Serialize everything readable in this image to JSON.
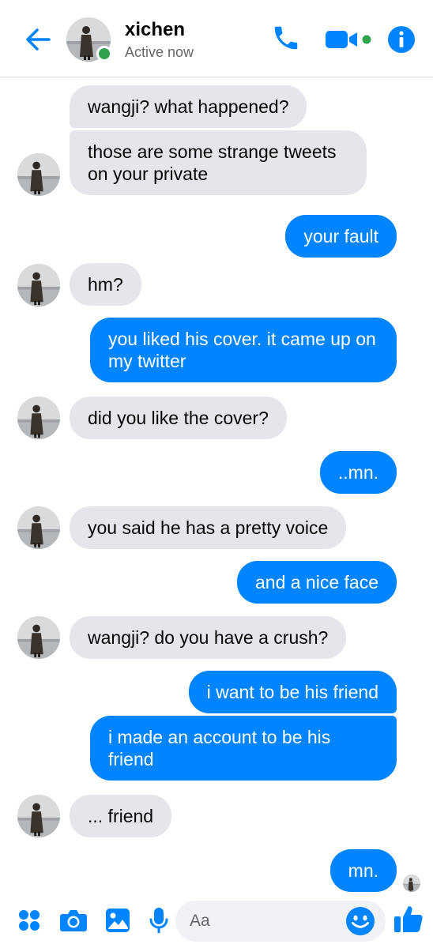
{
  "header": {
    "contact_name": "xichen",
    "status": "Active now",
    "status_color": "#31a24c"
  },
  "icons": {
    "back": "arrow-left-icon",
    "call": "phone-icon",
    "video": "video-camera-icon",
    "info": "info-icon",
    "apps": "apps-grid-icon",
    "camera": "camera-icon",
    "gallery": "image-icon",
    "mic": "microphone-icon",
    "emoji": "smiley-icon",
    "like": "thumbs-up-icon"
  },
  "colors": {
    "accent": "#0084ff",
    "received_bubble": "#e4e6eb",
    "sent_bubble": "#0084ff"
  },
  "messages": [
    {
      "dir": "received",
      "text": "wangji? what happened?"
    },
    {
      "dir": "received",
      "text": "those are some strange tweets on your private"
    },
    {
      "dir": "sent",
      "text": "your fault"
    },
    {
      "dir": "received",
      "text": "hm?"
    },
    {
      "dir": "sent",
      "text": "you liked his cover. it came up on my twitter"
    },
    {
      "dir": "received",
      "text": "did you like the cover?"
    },
    {
      "dir": "sent",
      "text": "..mn."
    },
    {
      "dir": "received",
      "text": "you said he has a pretty voice"
    },
    {
      "dir": "sent",
      "text": "and a nice face"
    },
    {
      "dir": "received",
      "text": "wangji? do you have a crush?"
    },
    {
      "dir": "sent",
      "text": "i want to be his friend"
    },
    {
      "dir": "sent",
      "text": "i made an account to be his friend"
    },
    {
      "dir": "received",
      "text": "... friend"
    },
    {
      "dir": "sent",
      "text": "mn."
    }
  ],
  "composer": {
    "placeholder": "Aa",
    "value": ""
  }
}
